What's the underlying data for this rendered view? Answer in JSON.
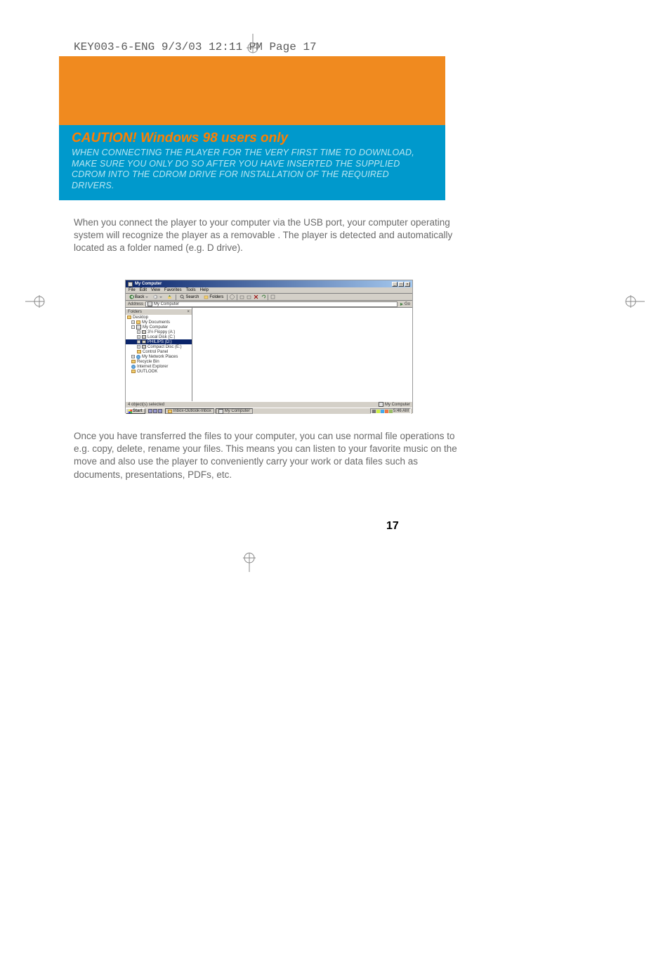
{
  "crop_info": "KEY003-6-ENG  9/3/03  12:11 PM  Page 17",
  "caution": {
    "title": "CAUTION!  Windows 98 users only",
    "body": "WHEN CONNECTING THE PLAYER FOR THE VERY FIRST TIME TO DOWNLOAD, MAKE SURE YOU ONLY DO SO AFTER YOU HAVE INSERTED THE SUPPLIED CDROM INTO THE CDROM DRIVE FOR INSTALLATION OF THE REQUIRED DRIVERS."
  },
  "para1": "When you connect the player to your computer via the USB port, your computer operating system will recognize the player as a removable                                               . The player is detected and automatically located as a folder named                                                (e.g. D drive).",
  "screenshot": {
    "title": "My Computer",
    "menu": [
      "File",
      "Edit",
      "View",
      "Favorites",
      "Tools",
      "Help"
    ],
    "toolbar": {
      "back": "Back",
      "search": "Search",
      "folders": "Folders"
    },
    "address_label": "Address",
    "address_value": "My Computer",
    "go": "Go",
    "tree_header": "Folders",
    "tree": {
      "desktop": "Desktop",
      "my_documents": "My Documents",
      "my_computer": "My Computer",
      "floppy": "3½ Floppy (A:)",
      "local_disk": "Local Disk (C:)",
      "removable": "PHILIPS (D:)",
      "cd_drive": "Compact Disc (E:)",
      "control_panel": "Control Panel",
      "network": "My Network Places",
      "recycle": "Recycle Bin",
      "ie": "Internet Explorer",
      "outlook": "OUTLOOK"
    },
    "status_left": "4 object(s) selected",
    "status_right": "My Computer",
    "taskbar": {
      "start": "Start",
      "task1": "Inbox-Outlook-Inbox",
      "task2": "My Computer",
      "clock": "5:46 AM"
    }
  },
  "para2": "Once you have transferred the files to your computer, you can use normal file operations to e.g. copy, delete, rename your files. This means you can listen to your favorite music on the move and also use the player to conveniently carry your work or data files such as            documents,                     presentations, PDFs, etc.",
  "page_number": "17"
}
